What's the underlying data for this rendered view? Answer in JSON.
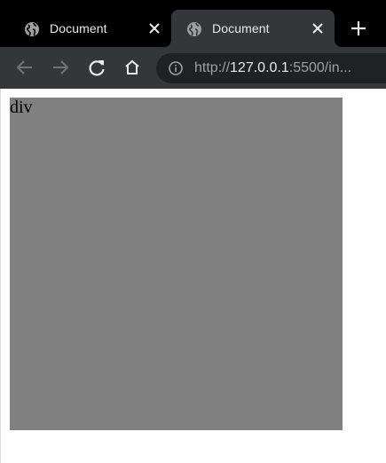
{
  "browser": {
    "tabs": [
      {
        "title": "Document",
        "active": false
      },
      {
        "title": "Document",
        "active": true
      }
    ],
    "new_tab_label": "+",
    "address_bar": {
      "scheme": "http://",
      "host": "127.0.0.1",
      "rest": ":5500/in..."
    },
    "colors": {
      "tabstrip": "#000000",
      "toolbar": "#35363a",
      "omnibox": "#202124",
      "text": "#e8eaed",
      "dim_text": "#9aa0a6"
    },
    "icons": {
      "favicon": "globe-icon",
      "close": "close-icon",
      "new_tab": "plus-icon",
      "back": "arrow-left-icon",
      "forward": "arrow-right-icon",
      "reload": "reload-icon",
      "home": "home-icon",
      "site_info": "info-icon"
    }
  },
  "page": {
    "div_text": "div",
    "div_color": "#808080"
  }
}
